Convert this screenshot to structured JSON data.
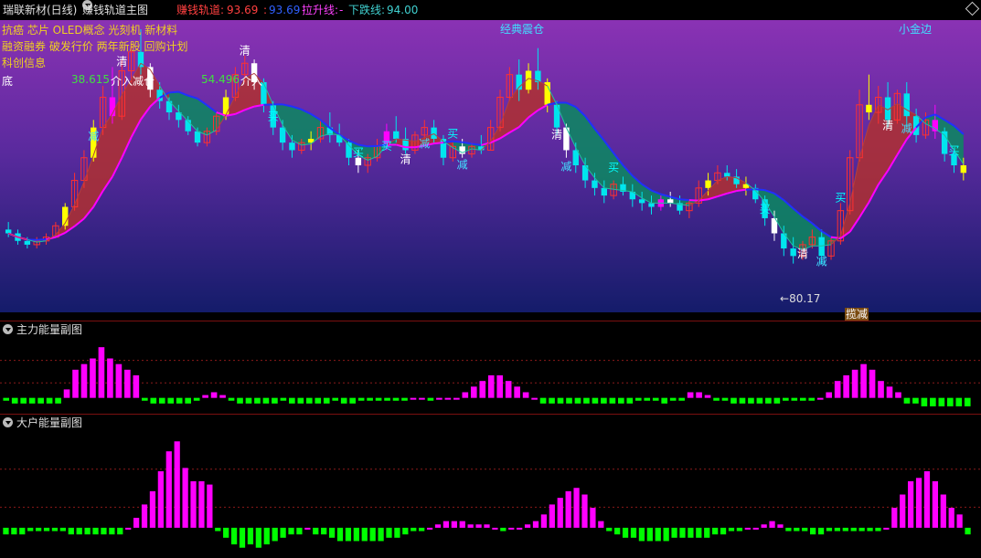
{
  "header": {
    "stock_title": "瑞联新材(日线)",
    "indicator_name": "赚钱轨道主图",
    "earn_track_label": "赚钱轨道:",
    "earn_track_value": "93.69",
    "second_value": "93.69",
    "rise_line_label": "拉升线:",
    "rise_line_value": "-",
    "fall_line_label": "下跌线:",
    "fall_line_value": "94.00"
  },
  "concept_tags": {
    "line1": "抗癌 芯片 OLED概念 光刻机 新材料",
    "line2": "融资融券 破发行价 两年新股 回购计划",
    "line3": "科创信息"
  },
  "main_labels": {
    "bottom": "底",
    "jd_shock": "经典震仓",
    "small_gold": "小金边",
    "val1": "38.615",
    "val1_text": "介入减仓",
    "val2": "54.496",
    "val2_text": "介入",
    "low_price": "80.17",
    "low_label_arrow": "←",
    "bottom_tag": "揽减",
    "buy": "买",
    "clear": "清",
    "reduce": "减"
  },
  "panels": {
    "panel1_title": "主力能量副图",
    "panel2_title": "大户能量副图"
  },
  "colors": {
    "up": "#ff3030",
    "down": "#00e5ee",
    "yellow": "#ffff00",
    "magenta": "#ff00ff",
    "green_bar": "#00ff00",
    "buy_text": "#00ffff",
    "red_band": "#b03030",
    "green_band": "#0a8a60"
  },
  "chart_data": [
    {
      "type": "candlestick",
      "title": "赚钱轨道主图",
      "annotations": [
        "经典震仓",
        "小金边",
        "38.615 介入减仓",
        "54.496 介入",
        "80.17",
        "揽减"
      ],
      "ylim": [
        78,
        150
      ],
      "ohlc": [
        [
          97,
          99,
          95,
          96
        ],
        [
          96,
          97,
          93,
          94
        ],
        [
          94,
          95,
          92,
          93
        ],
        [
          93,
          95,
          92,
          94
        ],
        [
          94,
          96,
          93,
          95
        ],
        [
          95,
          99,
          95,
          98
        ],
        [
          98,
          104,
          97,
          103
        ],
        [
          103,
          112,
          102,
          110
        ],
        [
          110,
          118,
          108,
          116
        ],
        [
          116,
          126,
          115,
          124
        ],
        [
          124,
          135,
          122,
          132
        ],
        [
          132,
          140,
          125,
          127
        ],
        [
          127,
          142,
          126,
          139
        ],
        [
          139,
          146,
          136,
          144
        ],
        [
          144,
          150,
          138,
          140
        ],
        [
          140,
          141,
          132,
          134
        ],
        [
          134,
          136,
          129,
          131
        ],
        [
          131,
          132,
          126,
          128
        ],
        [
          128,
          130,
          124,
          126
        ],
        [
          126,
          127,
          122,
          123
        ],
        [
          123,
          124,
          119,
          120
        ],
        [
          120,
          124,
          119,
          123
        ],
        [
          123,
          128,
          122,
          127
        ],
        [
          127,
          134,
          126,
          132
        ],
        [
          132,
          140,
          131,
          138
        ],
        [
          138,
          143,
          136,
          141
        ],
        [
          141,
          142,
          134,
          136
        ],
        [
          136,
          137,
          128,
          130
        ],
        [
          130,
          131,
          122,
          124
        ],
        [
          124,
          126,
          118,
          120
        ],
        [
          120,
          122,
          116,
          118
        ],
        [
          118,
          121,
          117,
          120
        ],
        [
          120,
          123,
          118,
          121
        ],
        [
          121,
          126,
          120,
          124
        ],
        [
          124,
          128,
          120,
          122
        ],
        [
          122,
          125,
          119,
          120
        ],
        [
          120,
          121,
          114,
          116
        ],
        [
          116,
          118,
          112,
          114
        ],
        [
          114,
          117,
          112,
          116
        ],
        [
          116,
          121,
          115,
          119
        ],
        [
          119,
          125,
          118,
          123
        ],
        [
          123,
          127,
          120,
          121
        ],
        [
          121,
          124,
          117,
          118
        ],
        [
          118,
          123,
          117,
          122
        ],
        [
          122,
          126,
          121,
          124
        ],
        [
          124,
          126,
          120,
          121
        ],
        [
          121,
          122,
          114,
          116
        ],
        [
          116,
          120,
          115,
          119
        ],
        [
          119,
          121,
          116,
          117
        ],
        [
          117,
          120,
          116,
          119
        ],
        [
          119,
          122,
          117,
          118
        ],
        [
          118,
          126,
          118,
          124
        ],
        [
          124,
          134,
          123,
          132
        ],
        [
          132,
          140,
          131,
          138
        ],
        [
          138,
          142,
          131,
          134
        ],
        [
          134,
          141,
          133,
          139
        ],
        [
          139,
          145,
          134,
          136
        ],
        [
          136,
          137,
          128,
          130
        ],
        [
          130,
          131,
          122,
          124
        ],
        [
          124,
          125,
          116,
          118
        ],
        [
          118,
          120,
          112,
          114
        ],
        [
          114,
          116,
          108,
          110
        ],
        [
          110,
          112,
          106,
          108
        ],
        [
          108,
          110,
          104,
          106
        ],
        [
          106,
          110,
          105,
          109
        ],
        [
          109,
          111,
          106,
          107
        ],
        [
          107,
          109,
          103,
          105
        ],
        [
          105,
          107,
          102,
          104
        ],
        [
          104,
          106,
          101,
          103
        ],
        [
          103,
          106,
          102,
          105
        ],
        [
          105,
          107,
          103,
          104
        ],
        [
          104,
          106,
          101,
          102
        ],
        [
          102,
          105,
          100,
          104
        ],
        [
          104,
          110,
          103,
          108
        ],
        [
          108,
          112,
          106,
          110
        ],
        [
          110,
          114,
          109,
          112
        ],
        [
          112,
          114,
          110,
          111
        ],
        [
          111,
          113,
          108,
          109
        ],
        [
          109,
          111,
          106,
          108
        ],
        [
          108,
          109,
          104,
          105
        ],
        [
          105,
          106,
          98,
          100
        ],
        [
          100,
          102,
          94,
          96
        ],
        [
          96,
          98,
          90,
          92
        ],
        [
          92,
          95,
          88,
          90
        ],
        [
          90,
          94,
          89,
          93
        ],
        [
          93,
          97,
          92,
          95
        ],
        [
          95,
          97,
          88,
          90
        ],
        [
          90,
          95,
          89,
          94
        ],
        [
          94,
          104,
          93,
          102
        ],
        [
          102,
          118,
          101,
          116
        ],
        [
          116,
          134,
          115,
          130
        ],
        [
          130,
          138,
          126,
          128
        ],
        [
          128,
          135,
          125,
          132
        ],
        [
          132,
          136,
          124,
          126
        ],
        [
          126,
          134,
          125,
          133
        ],
        [
          133,
          136,
          124,
          127
        ],
        [
          127,
          129,
          120,
          122
        ],
        [
          122,
          128,
          121,
          126
        ],
        [
          126,
          130,
          121,
          123
        ],
        [
          123,
          124,
          115,
          117
        ],
        [
          117,
          118,
          112,
          114
        ],
        [
          114,
          116,
          110,
          112
        ]
      ]
    },
    {
      "type": "bar",
      "title": "主力能量副图",
      "values": [
        -1,
        -2,
        -2,
        -2,
        -2,
        -2,
        -2,
        3,
        10,
        12,
        14,
        18,
        14,
        12,
        10,
        8,
        -1,
        -2,
        -2,
        -2,
        -2,
        -2,
        -1,
        1,
        2,
        1,
        -1,
        -2,
        -2,
        -2,
        -2,
        -2,
        -1,
        -2,
        -2,
        -2,
        -2,
        -2,
        -1,
        -2,
        -2,
        -1,
        -1,
        -1,
        -1,
        -1,
        -1,
        0,
        0,
        -1,
        0,
        0,
        0,
        2,
        4,
        6,
        8,
        8,
        6,
        4,
        2,
        0,
        -2,
        -2,
        -2,
        -2,
        -2,
        -2,
        -2,
        -2,
        -2,
        -2,
        -2,
        -1,
        -1,
        -1,
        -2,
        -1,
        -1,
        2,
        2,
        1,
        -1,
        -1,
        -2,
        -2,
        -2,
        -2,
        -2,
        -2,
        -1,
        -1,
        -1,
        -1,
        0,
        2,
        6,
        8,
        10,
        12,
        10,
        6,
        4,
        2,
        -2,
        -2,
        -3,
        -3,
        -3,
        -3,
        -3,
        -3
      ],
      "ylim": [
        -4,
        20
      ]
    },
    {
      "type": "bar",
      "title": "大户能量副图",
      "values": [
        -2,
        -2,
        -2,
        -1,
        -1,
        -1,
        -1,
        -1,
        -2,
        -2,
        -2,
        -2,
        -2,
        -2,
        -2,
        0,
        3,
        7,
        11,
        17,
        23,
        26,
        18,
        14,
        14,
        13,
        -1,
        -3,
        -5,
        -6,
        -5,
        -6,
        -5,
        -4,
        -3,
        -2,
        -2,
        0,
        -2,
        -2,
        -3,
        -4,
        -4,
        -4,
        -4,
        -4,
        -4,
        -3,
        -3,
        -2,
        -1,
        -1,
        0,
        1,
        2,
        2,
        2,
        1,
        1,
        1,
        0,
        -1,
        0,
        0,
        1,
        2,
        4,
        7,
        9,
        11,
        12,
        10,
        6,
        2,
        -1,
        -2,
        -3,
        -3,
        -4,
        -4,
        -4,
        -4,
        -3,
        -3,
        -3,
        -3,
        -3,
        -2,
        -2,
        -1,
        -1,
        0,
        0,
        1,
        2,
        1,
        -1,
        -1,
        -1,
        -2,
        -2,
        -1,
        -1,
        -1,
        -1,
        -1,
        -1,
        -1,
        0,
        6,
        10,
        14,
        15,
        17,
        14,
        10,
        6,
        4,
        -2
      ],
      "ylim": [
        -8,
        28
      ]
    }
  ]
}
